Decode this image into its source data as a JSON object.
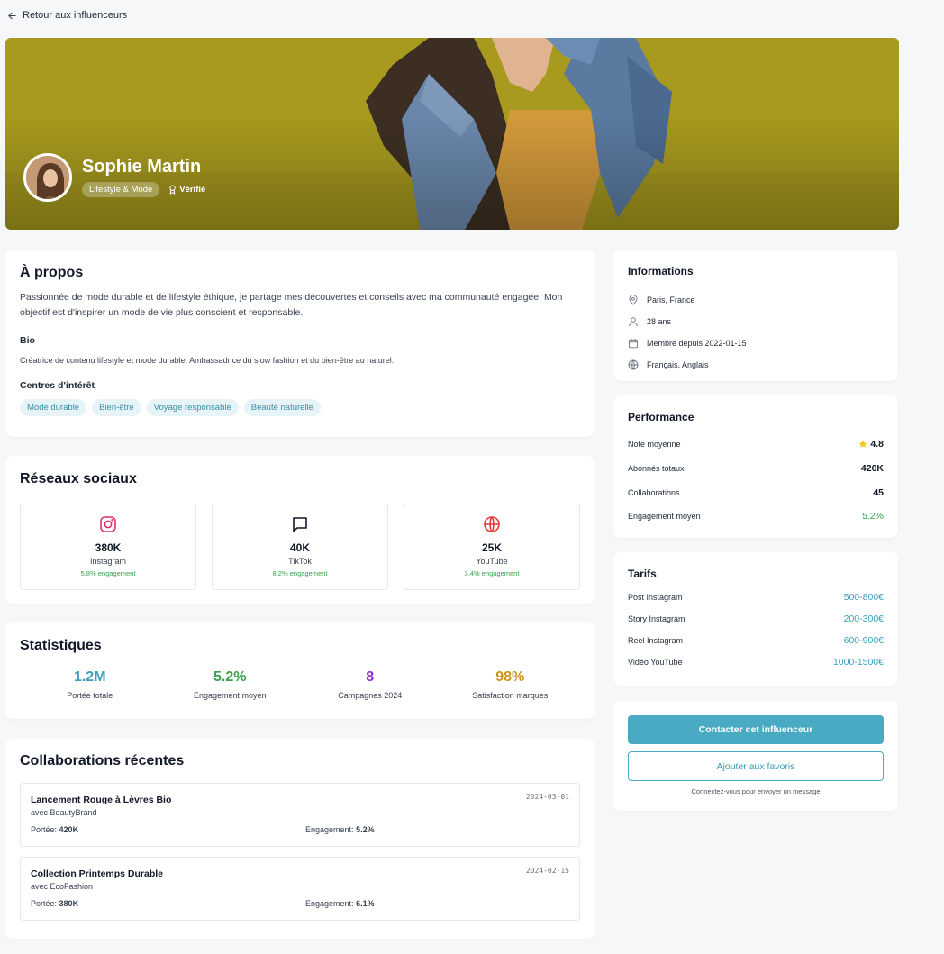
{
  "nav": {
    "back_label": "Retour aux influenceurs"
  },
  "profile": {
    "name": "Sophie Martin",
    "category": "Lifestyle & Mode",
    "verified_label": "Vérifié"
  },
  "about": {
    "title": "À propos",
    "description": "Passionnée de mode durable et de lifestyle éthique, je partage mes découvertes et conseils avec ma communauté engagée. Mon objectif est d'inspirer un mode de vie plus conscient et responsable.",
    "bio_title": "Bio",
    "bio": "Créatrice de contenu lifestyle et mode durable. Ambassadrice du slow fashion et du bien-être au naturel.",
    "interests_title": "Centres d'intérêt",
    "interests": [
      "Mode durable",
      "Bien-être",
      "Voyage responsable",
      "Beauté naturelle"
    ]
  },
  "social": {
    "title": "Réseaux sociaux",
    "networks": [
      {
        "icon": "instagram-icon",
        "count": "380K",
        "name": "Instagram",
        "engagement": "5.8% engagement",
        "color": "#e1306c"
      },
      {
        "icon": "chat-icon",
        "count": "40K",
        "name": "TikTok",
        "engagement": "8.2% engagement",
        "color": "#111827"
      },
      {
        "icon": "globe-icon",
        "count": "25K",
        "name": "YouTube",
        "engagement": "3.4% engagement",
        "color": "#e53935"
      }
    ]
  },
  "stats": {
    "title": "Statistiques",
    "items": [
      {
        "value": "1.2M",
        "label": "Portée totale",
        "color": "#3aa1bd"
      },
      {
        "value": "5.2%",
        "label": "Engagement moyen",
        "color": "#3aa04a"
      },
      {
        "value": "8",
        "label": "Campagnes 2024",
        "color": "#8b2fd6"
      },
      {
        "value": "98%",
        "label": "Satisfaction marques",
        "color": "#c9951e"
      }
    ]
  },
  "collabs": {
    "title": "Collaborations récentes",
    "items": [
      {
        "title": "Lancement Rouge à Lèvres Bio",
        "brand": "avec BeautyBrand",
        "date": "2024-03-01",
        "reach_label": "Portée:",
        "reach": "420K",
        "eng_label": "Engagement:",
        "engagement": "5.2%"
      },
      {
        "title": "Collection Printemps Durable",
        "brand": "avec EcoFashion",
        "date": "2024-02-15",
        "reach_label": "Portée:",
        "reach": "380K",
        "eng_label": "Engagement:",
        "engagement": "6.1%"
      }
    ]
  },
  "info": {
    "title": "Informations",
    "rows": [
      {
        "icon": "location-pin-icon",
        "text": "Paris, France"
      },
      {
        "icon": "user-icon",
        "text": "28 ans"
      },
      {
        "icon": "calendar-icon",
        "text": "Membre depuis 2022-01-15"
      },
      {
        "icon": "globe-icon",
        "text": "Français, Anglais"
      }
    ]
  },
  "performance": {
    "title": "Performance",
    "rows": [
      {
        "label": "Note moyenne",
        "value": "4.8"
      },
      {
        "label": "Abonnés totaux",
        "value": "420K"
      },
      {
        "label": "Collaborations",
        "value": "45"
      },
      {
        "label": "Engagement moyen",
        "value": "5.2%"
      }
    ],
    "star_color": "#f5c518",
    "engagement_color": "#3aa04a"
  },
  "tarifs": {
    "title": "Tarifs",
    "rows": [
      {
        "label": "Post Instagram",
        "value": "500-800€"
      },
      {
        "label": "Story Instagram",
        "value": "200-300€"
      },
      {
        "label": "Reel Instagram",
        "value": "600-900€"
      },
      {
        "label": "Vidéo YouTube",
        "value": "1000-1500€"
      }
    ]
  },
  "actions": {
    "contact_label": "Contacter cet influenceur",
    "favorite_label": "Ajouter aux favoris",
    "hint": "Connectez-vous pour envoyer un message"
  },
  "colors": {
    "accent": "#4aa9c3",
    "hero_bg": "#a79a1f"
  }
}
